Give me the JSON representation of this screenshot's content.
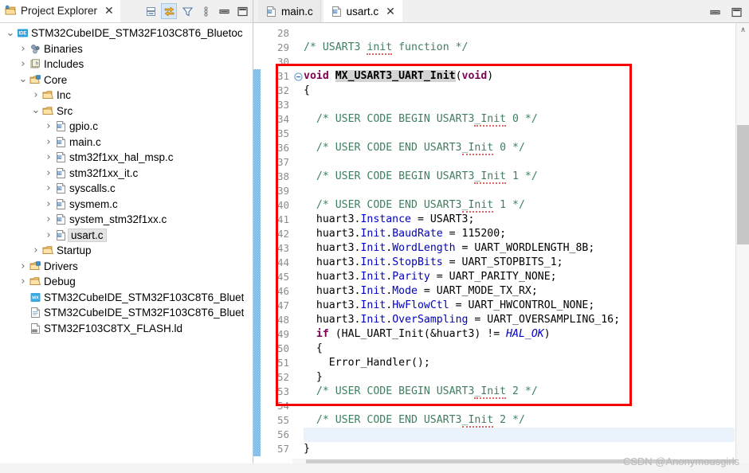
{
  "explorer": {
    "tab_title": "Project Explorer",
    "close_glyph": "✕",
    "toolbar": [
      {
        "name": "collapse-all-icon",
        "title": "Collapse All"
      },
      {
        "name": "link-with-editor-icon",
        "title": "Link with Editor"
      },
      {
        "name": "filter-icon",
        "title": "Filters"
      },
      {
        "name": "view-menu-icon",
        "title": "View Menu"
      },
      {
        "name": "minimize-icon",
        "title": "Minimize"
      },
      {
        "name": "maximize-icon",
        "title": "Maximize"
      }
    ],
    "tree": [
      {
        "label": "STM32CubeIDE_STM32F103C8T6_Bluetoc",
        "depth": 0,
        "arrow": "down",
        "icon": "ide-project-icon",
        "selected": false
      },
      {
        "label": "Binaries",
        "depth": 1,
        "arrow": "right",
        "icon": "binaries-icon",
        "selected": false
      },
      {
        "label": "Includes",
        "depth": 1,
        "arrow": "right",
        "icon": "includes-icon",
        "selected": false
      },
      {
        "label": "Core",
        "depth": 1,
        "arrow": "down",
        "icon": "source-folder-icon",
        "selected": false
      },
      {
        "label": "Inc",
        "depth": 2,
        "arrow": "right",
        "icon": "folder-icon",
        "selected": false
      },
      {
        "label": "Src",
        "depth": 2,
        "arrow": "down",
        "icon": "folder-icon",
        "selected": false
      },
      {
        "label": "gpio.c",
        "depth": 3,
        "arrow": "right",
        "icon": "c-file-icon",
        "selected": false
      },
      {
        "label": "main.c",
        "depth": 3,
        "arrow": "right",
        "icon": "c-file-icon",
        "selected": false
      },
      {
        "label": "stm32f1xx_hal_msp.c",
        "depth": 3,
        "arrow": "right",
        "icon": "c-file-icon",
        "selected": false
      },
      {
        "label": "stm32f1xx_it.c",
        "depth": 3,
        "arrow": "right",
        "icon": "c-file-icon",
        "selected": false
      },
      {
        "label": "syscalls.c",
        "depth": 3,
        "arrow": "right",
        "icon": "c-file-icon",
        "selected": false
      },
      {
        "label": "sysmem.c",
        "depth": 3,
        "arrow": "right",
        "icon": "c-file-icon",
        "selected": false
      },
      {
        "label": "system_stm32f1xx.c",
        "depth": 3,
        "arrow": "right",
        "icon": "c-file-icon",
        "selected": false
      },
      {
        "label": "usart.c",
        "depth": 3,
        "arrow": "right",
        "icon": "c-file-icon",
        "selected": true
      },
      {
        "label": "Startup",
        "depth": 2,
        "arrow": "right",
        "icon": "folder-icon",
        "selected": false
      },
      {
        "label": "Drivers",
        "depth": 1,
        "arrow": "right",
        "icon": "source-folder-icon",
        "selected": false
      },
      {
        "label": "Debug",
        "depth": 1,
        "arrow": "right",
        "icon": "folder-icon",
        "selected": false
      },
      {
        "label": "STM32CubeIDE_STM32F103C8T6_Bluet",
        "depth": 1,
        "arrow": "none",
        "icon": "ioc-file-icon",
        "selected": false
      },
      {
        "label": "STM32CubeIDE_STM32F103C8T6_Bluet",
        "depth": 1,
        "arrow": "none",
        "icon": "text-file-icon",
        "selected": false
      },
      {
        "label": "STM32F103C8TX_FLASH.ld",
        "depth": 1,
        "arrow": "none",
        "icon": "ld-file-icon",
        "selected": false
      }
    ]
  },
  "editor": {
    "tabs": [
      {
        "label": "main.c",
        "active": false,
        "closable": false,
        "icon": "c-file-icon"
      },
      {
        "label": "usart.c",
        "active": true,
        "closable": true,
        "icon": "c-file-icon"
      }
    ],
    "close_glyph": "✕",
    "window_controls": [
      {
        "name": "minimize-icon",
        "title": "Minimize"
      },
      {
        "name": "maximize-icon",
        "title": "Maximize"
      }
    ],
    "first_line_number": 28,
    "current_line": 56,
    "change_bar_from_line": 31,
    "change_bar_to_line": 57,
    "fold_marker_line": 31,
    "scrollbar": {
      "up_glyph": "∧",
      "down_glyph": "∨",
      "left_glyph": "‹"
    },
    "lines": [
      {
        "n": 28,
        "html": ""
      },
      {
        "n": 29,
        "html": "<span class=\"cmt\">/* USART3 <span class=\"spell\">init</span> function */</span>"
      },
      {
        "n": 30,
        "html": ""
      },
      {
        "n": 31,
        "html": "<span class=\"kw\">void</span> <span class=\"fn\">MX_USART3_UART_Init</span>(<span class=\"kw\">void</span>)"
      },
      {
        "n": 32,
        "html": "{"
      },
      {
        "n": 33,
        "html": ""
      },
      {
        "n": 34,
        "html": "  <span class=\"cmt\">/* USER CODE BEGIN USART3<span class=\"spell\">_Init</span> 0 */</span>"
      },
      {
        "n": 35,
        "html": ""
      },
      {
        "n": 36,
        "html": "  <span class=\"cmt\">/* USER CODE END USART3<span class=\"spell\">_Init</span> 0 */</span>"
      },
      {
        "n": 37,
        "html": ""
      },
      {
        "n": 38,
        "html": "  <span class=\"cmt\">/* USER CODE BEGIN USART3<span class=\"spell\">_Init</span> 1 */</span>"
      },
      {
        "n": 39,
        "html": ""
      },
      {
        "n": 40,
        "html": "  <span class=\"cmt\">/* USER CODE END USART3<span class=\"spell\">_Init</span> 1 */</span>"
      },
      {
        "n": 41,
        "html": "  huart3.<span class=\"fld\">Instance</span> = USART3;"
      },
      {
        "n": 42,
        "html": "  huart3.<span class=\"fld\">Init</span>.<span class=\"fld\">BaudRate</span> = 115200;"
      },
      {
        "n": 43,
        "html": "  huart3.<span class=\"fld\">Init</span>.<span class=\"fld\">WordLength</span> = UART_WORDLENGTH_8B;"
      },
      {
        "n": 44,
        "html": "  huart3.<span class=\"fld\">Init</span>.<span class=\"fld\">StopBits</span> = UART_STOPBITS_1;"
      },
      {
        "n": 45,
        "html": "  huart3.<span class=\"fld\">Init</span>.<span class=\"fld\">Parity</span> = UART_PARITY_NONE;"
      },
      {
        "n": 46,
        "html": "  huart3.<span class=\"fld\">Init</span>.<span class=\"fld\">Mode</span> = UART_MODE_TX_RX;"
      },
      {
        "n": 47,
        "html": "  huart3.<span class=\"fld\">Init</span>.<span class=\"fld\">HwFlowCtl</span> = UART_HWCONTROL_NONE;"
      },
      {
        "n": 48,
        "html": "  huart3.<span class=\"fld\">Init</span>.<span class=\"fld\">OverSampling</span> = UART_OVERSAMPLING_16;"
      },
      {
        "n": 49,
        "html": "  <span class=\"kw\">if</span> (HAL_UART_Init(&amp;huart3) != <span class=\"ital\">HAL_OK</span>)"
      },
      {
        "n": 50,
        "html": "  {"
      },
      {
        "n": 51,
        "html": "    Error_Handler();"
      },
      {
        "n": 52,
        "html": "  }"
      },
      {
        "n": 53,
        "html": "  <span class=\"cmt\">/* USER CODE BEGIN USART3<span class=\"spell\">_Init</span> 2 */</span>"
      },
      {
        "n": 54,
        "html": ""
      },
      {
        "n": 55,
        "html": "  <span class=\"cmt\">/* USER CODE END USART3<span class=\"spell\">_Init</span> 2 */</span>"
      },
      {
        "n": 56,
        "html": ""
      },
      {
        "n": 57,
        "html": "}"
      }
    ]
  },
  "annotation": {
    "name": "red-highlight-box",
    "color": "#f40000",
    "covers_lines": "30-54"
  },
  "watermark": {
    "text": "CSDN @Anonymousgirls"
  },
  "colors": {
    "accent": "#d6e8f7",
    "change_bar": "#6fb3e8",
    "current_line": "#eaf2fb",
    "keyword": "#7f0055",
    "comment": "#3f7f5f",
    "field": "#0000c0",
    "annotation": "#f40000"
  }
}
